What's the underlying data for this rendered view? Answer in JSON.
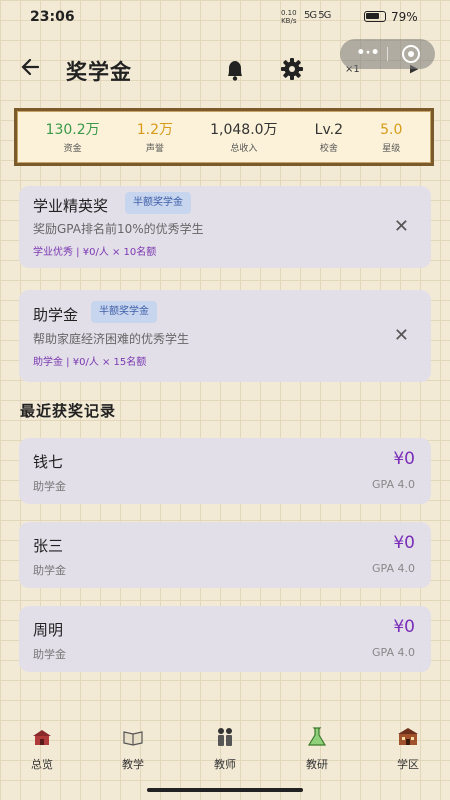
{
  "status_bar": {
    "time": "23:06",
    "net_speed": "0.10",
    "net_unit": "KB/s",
    "signal": "5G  5G",
    "battery_pct": "79%",
    "battery_level": 0.79
  },
  "header": {
    "title": "奖学金",
    "speed_label": "×1"
  },
  "stats": [
    {
      "value": "130.2万",
      "label": "资金",
      "color": "#3a9a4a"
    },
    {
      "value": "1.2万",
      "label": "声誉",
      "color": "#d89a1a"
    },
    {
      "value": "1,048.0万",
      "label": "总收入",
      "color": "#333333"
    },
    {
      "value": "Lv.2",
      "label": "校舍",
      "color": "#333333"
    },
    {
      "value": "5.0",
      "label": "星级",
      "color": "#d89a1a"
    }
  ],
  "scholarships": [
    {
      "name": "学业精英奖",
      "badge": "半额奖学金",
      "desc": "奖励GPA排名前10%的优秀学生",
      "meta": "学业优秀 | ¥0/人 × 10名额"
    },
    {
      "name": "助学金",
      "badge": "半额奖学金",
      "desc": "帮助家庭经济困难的优秀学生",
      "meta": "助学金 | ¥0/人 × 15名额"
    }
  ],
  "section_title": "最近获奖记录",
  "records": [
    {
      "name": "钱七",
      "type": "助学金",
      "amount": "¥0",
      "gpa": "GPA 4.0"
    },
    {
      "name": "张三",
      "type": "助学金",
      "amount": "¥0",
      "gpa": "GPA 4.0"
    },
    {
      "name": "周明",
      "type": "助学金",
      "amount": "¥0",
      "gpa": "GPA 4.0"
    }
  ],
  "nav": [
    {
      "label": "总览",
      "icon": "school-building-icon"
    },
    {
      "label": "教学",
      "icon": "book-icon"
    },
    {
      "label": "教师",
      "icon": "teachers-icon"
    },
    {
      "label": "教研",
      "icon": "flask-icon"
    },
    {
      "label": "学区",
      "icon": "campus-icon"
    }
  ]
}
